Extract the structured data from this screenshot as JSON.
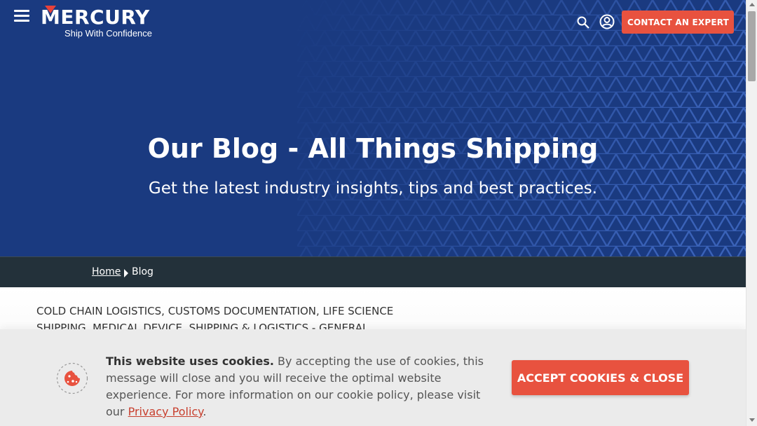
{
  "header": {
    "logo_text": "MERCURY",
    "tagline": "Ship With Confidence",
    "contact_label": "CONTACT AN EXPERT"
  },
  "hero": {
    "title": "Our Blog - All Things Shipping",
    "subtitle": "Get the latest industry insights, tips and best practices."
  },
  "breadcrumb": {
    "home": "Home",
    "current": "Blog"
  },
  "content": {
    "categories": "COLD CHAIN LOGISTICS, CUSTOMS DOCUMENTATION, LIFE SCIENCE SHIPPING, MEDICAL DEVICE, SHIPPING & LOGISTICS - GENERAL"
  },
  "cookie": {
    "title": "This website uses cookies.",
    "body": "By accepting the use of cookies, this message will close and you will receive the optimal website experience. For more information on our cookie policy, please visit our",
    "link": "Privacy Policy",
    "end": ".",
    "accept_label": "ACCEPT COOKIES & CLOSE"
  },
  "colors": {
    "hero_bg": "#1a3a80",
    "accent": "#e8523f",
    "breadcrumb_bg": "#23313a"
  },
  "icons": [
    "hamburger-menu-icon",
    "search-icon",
    "user-account-icon",
    "cookie-icon"
  ]
}
